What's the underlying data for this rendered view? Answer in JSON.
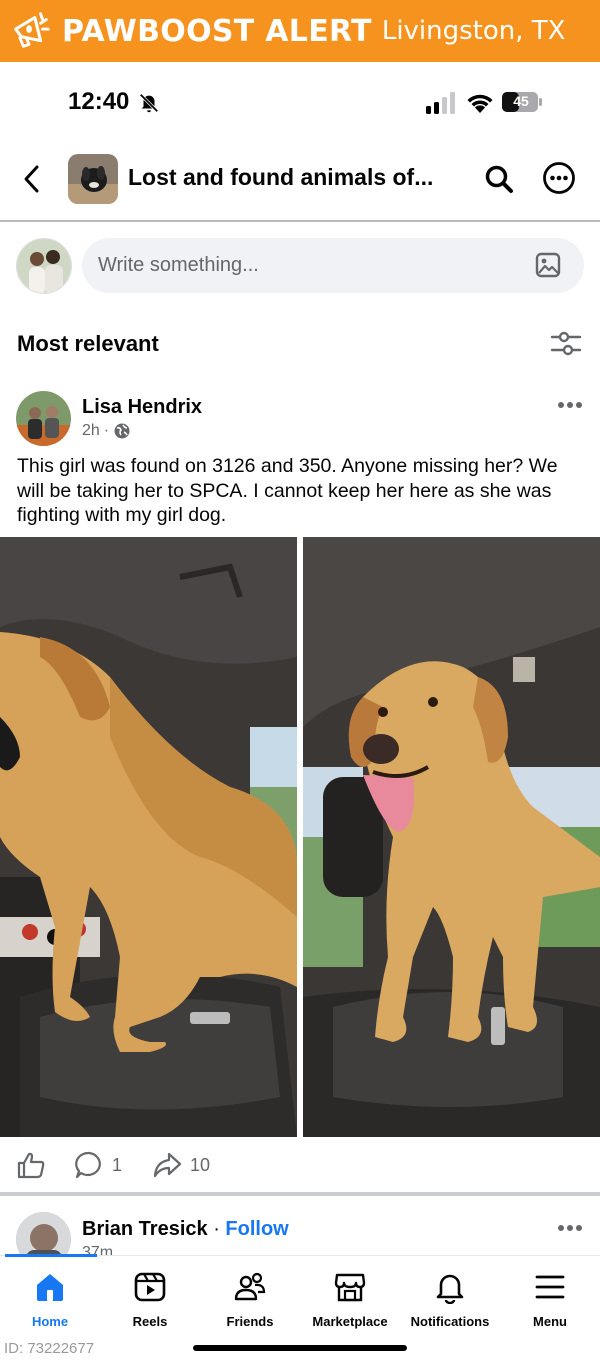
{
  "banner": {
    "brand": "PAWBOOST ALERT",
    "location": "Livingston, TX",
    "color": "#f6921e"
  },
  "status_bar": {
    "time": "12:40",
    "battery": "45"
  },
  "header": {
    "group_title": "Lost and found animals of..."
  },
  "composer": {
    "placeholder": "Write something..."
  },
  "feed": {
    "sort_label": "Most relevant"
  },
  "post": {
    "author": "Lisa Hendrix",
    "time": "2h",
    "text": "This girl was found on 3126 and 350. Anyone missing her? We will be taking her to SPCA. I cannot keep her here as she was fighting with my girl dog.",
    "comments": "1",
    "shares": "10"
  },
  "next_post": {
    "author": "Brian Tresick",
    "separator": "·",
    "follow_label": "Follow",
    "time": "37m"
  },
  "tabs": [
    {
      "label": "Home",
      "icon": "home-icon",
      "active": true
    },
    {
      "label": "Reels",
      "icon": "reels-icon"
    },
    {
      "label": "Friends",
      "icon": "friends-icon"
    },
    {
      "label": "Marketplace",
      "icon": "marketplace-icon"
    },
    {
      "label": "Notifications",
      "icon": "bell-icon"
    },
    {
      "label": "Menu",
      "icon": "menu-icon"
    }
  ],
  "footer": {
    "photo_id": "ID: 73222677"
  },
  "colors": {
    "accent": "#1877f2",
    "text": "#050505",
    "muted": "#65676b"
  }
}
